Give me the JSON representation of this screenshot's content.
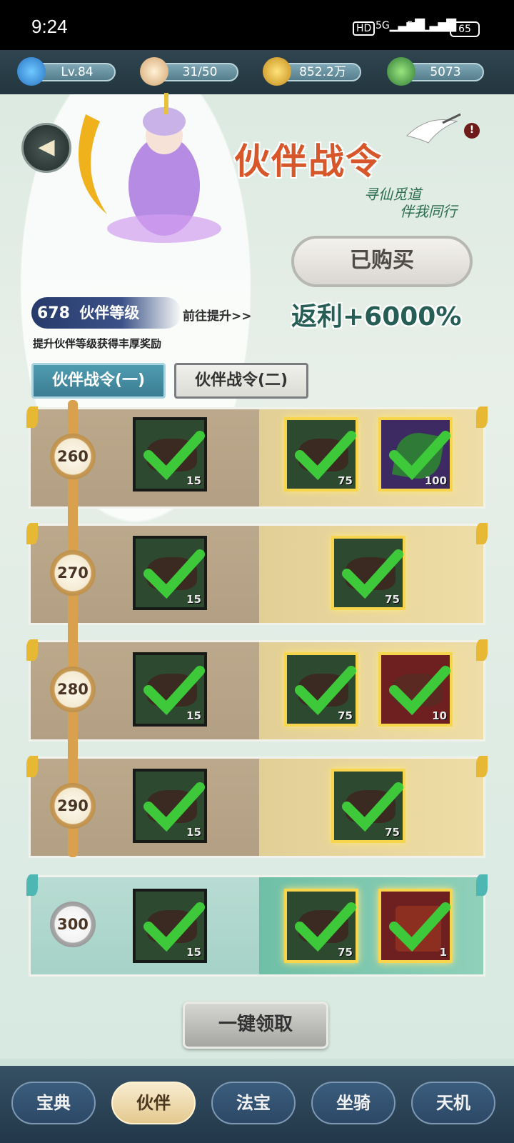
{
  "status_bar": {
    "time": "9:24",
    "hd": "HD",
    "network1": "5G",
    "network2": "5G",
    "battery": "65"
  },
  "resources": {
    "level": "Lv.84",
    "stamina": "31/50",
    "coins": "852.2万",
    "leaves": "5073"
  },
  "header": {
    "title": "伙伴战令",
    "subtitle_line1": "寻仙觅道",
    "subtitle_line2": "伴我同行",
    "alert": "!",
    "bought_label": "已购买",
    "rebate_text": "返利+6000%"
  },
  "partner_level": {
    "value": "678",
    "label": "伙伴等级",
    "goto_link": "前往提升>>",
    "hint": "提升伙伴等级获得丰厚奖励"
  },
  "tabs": [
    {
      "label": "伙伴战令(一)",
      "active": true
    },
    {
      "label": "伙伴战令(二)",
      "active": false
    }
  ],
  "reward_rows": [
    {
      "level": "260",
      "free": {
        "count": "15"
      },
      "paid": [
        {
          "count": "75",
          "kind": "obj"
        },
        {
          "count": "100",
          "kind": "leaf"
        }
      ]
    },
    {
      "level": "270",
      "free": {
        "count": "15"
      },
      "paid": [
        {
          "count": "75",
          "kind": "obj"
        }
      ]
    },
    {
      "level": "280",
      "free": {
        "count": "15"
      },
      "paid": [
        {
          "count": "75",
          "kind": "obj"
        },
        {
          "count": "10",
          "kind": "red"
        }
      ]
    },
    {
      "level": "290",
      "free": {
        "count": "15"
      },
      "paid": [
        {
          "count": "75",
          "kind": "obj"
        }
      ]
    },
    {
      "level": "300",
      "free": {
        "count": "15"
      },
      "paid": [
        {
          "count": "75",
          "kind": "obj"
        },
        {
          "count": "1",
          "kind": "box"
        }
      ]
    }
  ],
  "claim_all_label": "一键领取",
  "bottom_nav": [
    {
      "label": "宝典",
      "active": false
    },
    {
      "label": "伙伴",
      "active": true
    },
    {
      "label": "法宝",
      "active": false
    },
    {
      "label": "坐骑",
      "active": false
    },
    {
      "label": "天机",
      "active": false
    }
  ],
  "colors": {
    "accent_title": "#d7572b",
    "check_green": "#3ec93a",
    "gold_border": "#f7d64d"
  }
}
